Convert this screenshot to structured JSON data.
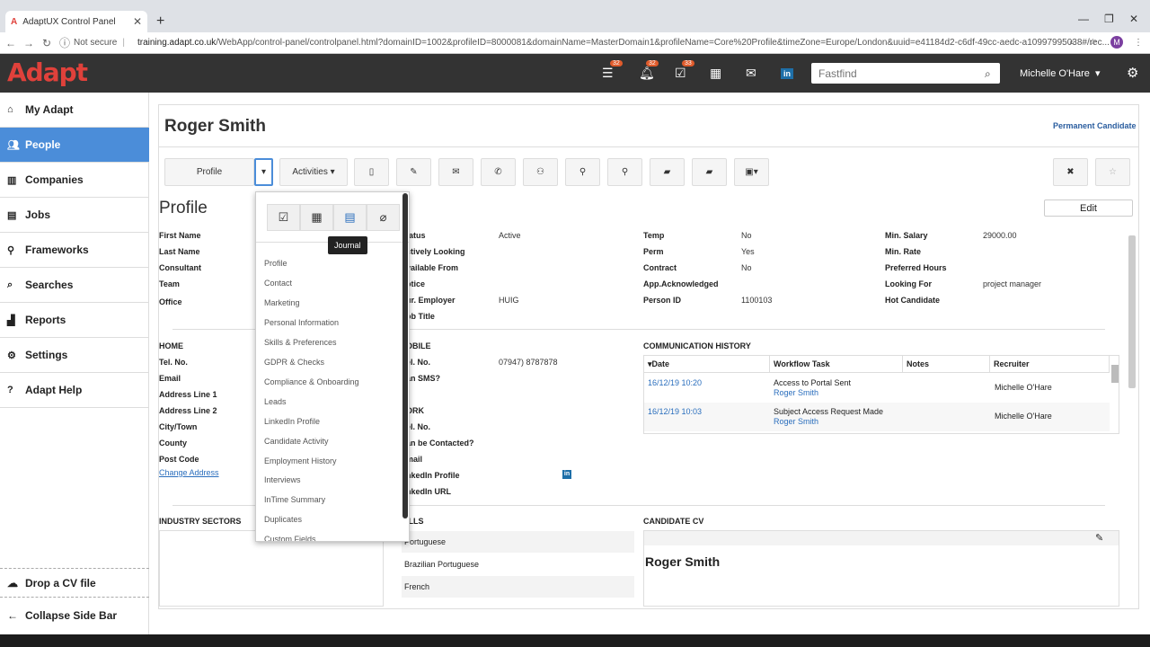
{
  "browser": {
    "tab_title": "AdaptUX Control Panel",
    "not_secure": "Not secure",
    "url_host": "training.adapt.co.uk",
    "url_path": "/WebApp/control-panel/controlpanel.html?domainID=1002&profileID=8000081&domainName=MasterDomain1&profileName=Core%20Profile&timeZone=Europe/London&uuid=e41184d2-c6df-49cc-aedc-a10997995038#/rec...",
    "profile_initial": "M"
  },
  "header": {
    "logo": "Adapt",
    "badges": {
      "menu": "32",
      "bell": "32",
      "tasks": "33"
    },
    "search_placeholder": "Fastfind",
    "user": "Michelle O'Hare"
  },
  "sidebar": {
    "items": [
      {
        "label": "My Adapt",
        "icon": "home-icon"
      },
      {
        "label": "People",
        "icon": "people-icon"
      },
      {
        "label": "Companies",
        "icon": "building-icon"
      },
      {
        "label": "Jobs",
        "icon": "briefcase-icon"
      },
      {
        "label": "Frameworks",
        "icon": "frameworks-icon"
      },
      {
        "label": "Searches",
        "icon": "search-icon"
      },
      {
        "label": "Reports",
        "icon": "chart-icon"
      },
      {
        "label": "Settings",
        "icon": "gear-icon"
      },
      {
        "label": "Adapt Help",
        "icon": "help-icon"
      }
    ],
    "drop_cv": "Drop a CV file",
    "collapse": "Collapse Side Bar"
  },
  "record": {
    "name": "Roger Smith",
    "type": "Permanent Candidate",
    "profile_btn": "Profile",
    "activities_btn": "Activities",
    "section": "Profile",
    "edit": "Edit"
  },
  "fields_left": [
    "First Name",
    "Last Name",
    "Consultant",
    "Team",
    "Office"
  ],
  "fields_mid": [
    {
      "label": "tatus",
      "value": "Active"
    },
    {
      "label": "ctively Looking",
      "value": ""
    },
    {
      "label": "vailable From",
      "value": ""
    },
    {
      "label": "otice",
      "value": ""
    },
    {
      "label": "ur. Employer",
      "value": "HUIG"
    },
    {
      "label": "ob Title",
      "value": ""
    }
  ],
  "fields_r1": [
    {
      "label": "Temp",
      "value": "No"
    },
    {
      "label": "Perm",
      "value": "Yes"
    },
    {
      "label": "Contract",
      "value": "No"
    },
    {
      "label": "App.Acknowledged",
      "value": ""
    },
    {
      "label": "Person ID",
      "value": "1100103"
    }
  ],
  "fields_r2": [
    {
      "label": "Min. Salary",
      "value": "29000.00"
    },
    {
      "label": "Min. Rate",
      "value": ""
    },
    {
      "label": "Preferred Hours",
      "value": ""
    },
    {
      "label": "Looking For",
      "value": "project manager"
    },
    {
      "label": "Hot Candidate",
      "value": ""
    }
  ],
  "home": {
    "heading": "HOME",
    "labels": [
      "Tel. No.",
      "Email",
      "Address Line 1",
      "Address Line 2",
      "City/Town",
      "County",
      "Post Code"
    ],
    "change_address": "Change Address"
  },
  "mobile": {
    "heading": "OBILE",
    "labels": [
      "el. No.",
      "an SMS?",
      "",
      "ORK",
      "el. No.",
      "an be Contacted?",
      "mail",
      "nkedIn Profile",
      "nkedIn URL"
    ],
    "tel": "07947) 8787878"
  },
  "comm": {
    "heading": "COMMUNICATION HISTORY",
    "cols": [
      "Date",
      "Workflow Task",
      "Notes",
      "Recruiter"
    ],
    "rows": [
      {
        "date": "16/12/19 10:20",
        "time": "10:20",
        "task": "Access to Portal Sent",
        "who": "Roger Smith",
        "recruiter": "Michelle O'Hare"
      },
      {
        "date": "16/12/19 10:03",
        "time": "10:03",
        "task": "Subject Access Request Made",
        "who": "Roger Smith",
        "recruiter": "Michelle O'Hare"
      }
    ]
  },
  "industry": {
    "heading": "INDUSTRY SECTORS"
  },
  "skills": {
    "heading": "ILLS",
    "items": [
      "Portuguese",
      "Brazilian Portuguese",
      "French"
    ]
  },
  "cv": {
    "heading": "CANDIDATE CV",
    "name": "Roger Smith"
  },
  "dropdown": {
    "tooltip": "Journal",
    "items": [
      "Profile",
      "Contact",
      "Marketing",
      "Personal Information",
      "Skills & Preferences",
      "GDPR & Checks",
      "Compliance & Onboarding",
      "Leads",
      "LinkedIn Profile",
      "Candidate Activity",
      "Employment History",
      "Interviews",
      "InTime Summary",
      "Duplicates",
      "Custom Fields"
    ]
  }
}
